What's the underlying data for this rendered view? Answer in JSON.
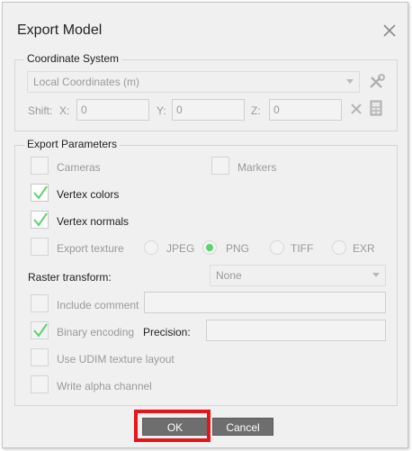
{
  "dialog": {
    "title": "Export Model"
  },
  "coordinate_system": {
    "legend": "Coordinate System",
    "system_value": "Local Coordinates (m)",
    "shift_label": "Shift:",
    "x_label": "X:",
    "x_value": "0",
    "y_label": "Y:",
    "y_value": "0",
    "z_label": "Z:",
    "z_value": "0"
  },
  "export_parameters": {
    "legend": "Export Parameters",
    "cameras_label": "Cameras",
    "markers_label": "Markers",
    "vertex_colors_label": "Vertex colors",
    "vertex_normals_label": "Vertex normals",
    "export_texture_label": "Export texture",
    "jpeg_label": "JPEG",
    "png_label": "PNG",
    "tiff_label": "TIFF",
    "exr_label": "EXR",
    "raster_transform_label": "Raster transform:",
    "raster_transform_value": "None",
    "include_comment_label": "Include comment",
    "binary_encoding_label": "Binary encoding",
    "precision_label": "Precision:",
    "udim_label": "Use UDIM texture layout",
    "alpha_label": "Write alpha channel"
  },
  "buttons": {
    "ok": "OK",
    "cancel": "Cancel"
  },
  "colors": {
    "check_green": "#5bd36e",
    "highlight_red": "#e8141c",
    "button_gray": "#6e6e6e"
  }
}
